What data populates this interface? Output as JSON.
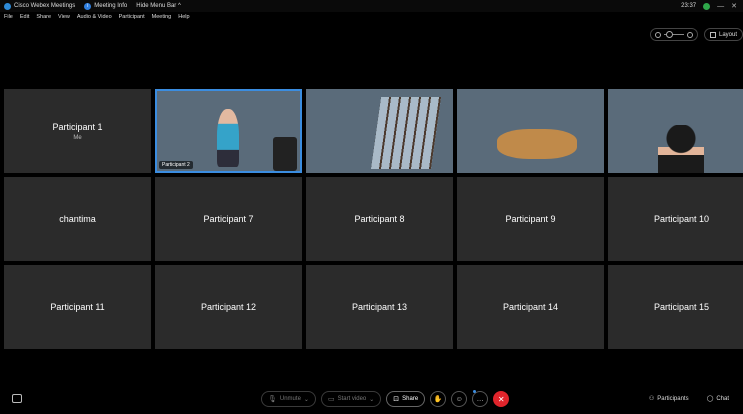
{
  "window": {
    "app_title": "Cisco Webex Meetings",
    "meeting_info": "Meeting Info",
    "hide_menu": "Hide Menu Bar ^",
    "time": "23:37",
    "minimize": "—",
    "close": "✕"
  },
  "menu": [
    "File",
    "Edit",
    "Share",
    "View",
    "Audio & Video",
    "Participant",
    "Meeting",
    "Help"
  ],
  "toolbar": {
    "layout_label": "Layout"
  },
  "tiles": [
    {
      "name": "Participant 1",
      "sub": "Me"
    },
    {
      "name": "Participant 2",
      "video_label": "Participant 2"
    },
    {
      "name": ""
    },
    {
      "name": ""
    },
    {
      "name": ""
    },
    {
      "name": "chantima"
    },
    {
      "name": "Participant 7"
    },
    {
      "name": "Participant 8"
    },
    {
      "name": "Participant 9"
    },
    {
      "name": "Participant 10"
    },
    {
      "name": "Participant 11"
    },
    {
      "name": "Participant 12"
    },
    {
      "name": "Participant 13"
    },
    {
      "name": "Participant 14"
    },
    {
      "name": "Participant 15"
    }
  ],
  "controls": {
    "unmute": "Unmute",
    "start_video": "Start video",
    "share": "Share",
    "participants": "Participants",
    "chat": "Chat"
  }
}
